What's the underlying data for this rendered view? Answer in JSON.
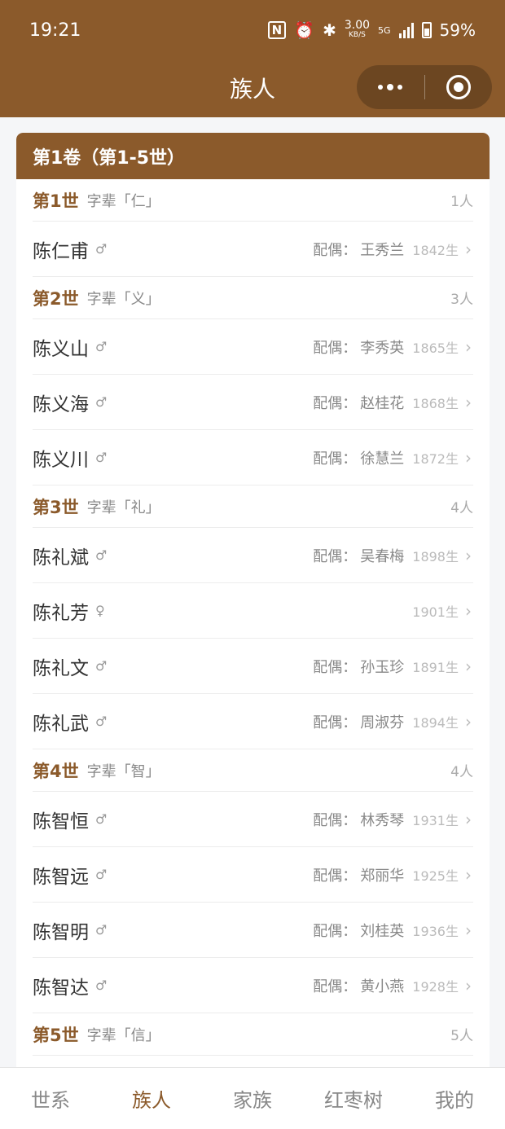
{
  "status_bar": {
    "time": "19:21",
    "speed_value": "3.00",
    "speed_unit": "KB/S",
    "network": "5G",
    "battery": "59%",
    "nfc": "N",
    "alarm": "⏰",
    "bluetooth": "✱"
  },
  "nav": {
    "title": "族人"
  },
  "colors": {
    "brand": "#8b5a2b",
    "background": "#f5f6f8"
  },
  "volume": {
    "title": "第1卷（第1-5世）"
  },
  "generations": [
    {
      "title": "第1世",
      "zibei": "字辈「仁」",
      "count": "1人",
      "members": [
        {
          "name": "陈仁甫",
          "gender": "♂",
          "spouse_label": "配偶：",
          "spouse": "王秀兰",
          "birth": "1842生"
        }
      ]
    },
    {
      "title": "第2世",
      "zibei": "字辈「义」",
      "count": "3人",
      "members": [
        {
          "name": "陈义山",
          "gender": "♂",
          "spouse_label": "配偶：",
          "spouse": "李秀英",
          "birth": "1865生"
        },
        {
          "name": "陈义海",
          "gender": "♂",
          "spouse_label": "配偶：",
          "spouse": "赵桂花",
          "birth": "1868生"
        },
        {
          "name": "陈义川",
          "gender": "♂",
          "spouse_label": "配偶：",
          "spouse": "徐慧兰",
          "birth": "1872生"
        }
      ]
    },
    {
      "title": "第3世",
      "zibei": "字辈「礼」",
      "count": "4人",
      "members": [
        {
          "name": "陈礼斌",
          "gender": "♂",
          "spouse_label": "配偶：",
          "spouse": "吴春梅",
          "birth": "1898生"
        },
        {
          "name": "陈礼芳",
          "gender": "♀",
          "spouse_label": "",
          "spouse": "",
          "birth": "1901生"
        },
        {
          "name": "陈礼文",
          "gender": "♂",
          "spouse_label": "配偶：",
          "spouse": "孙玉珍",
          "birth": "1891生"
        },
        {
          "name": "陈礼武",
          "gender": "♂",
          "spouse_label": "配偶：",
          "spouse": "周淑芬",
          "birth": "1894生"
        }
      ]
    },
    {
      "title": "第4世",
      "zibei": "字辈「智」",
      "count": "4人",
      "members": [
        {
          "name": "陈智恒",
          "gender": "♂",
          "spouse_label": "配偶：",
          "spouse": "林秀琴",
          "birth": "1931生"
        },
        {
          "name": "陈智远",
          "gender": "♂",
          "spouse_label": "配偶：",
          "spouse": "郑丽华",
          "birth": "1925生"
        },
        {
          "name": "陈智明",
          "gender": "♂",
          "spouse_label": "配偶：",
          "spouse": "刘桂英",
          "birth": "1936生"
        },
        {
          "name": "陈智达",
          "gender": "♂",
          "spouse_label": "配偶：",
          "spouse": "黄小燕",
          "birth": "1928生"
        }
      ]
    },
    {
      "title": "第5世",
      "zibei": "字辈「信」",
      "count": "5人",
      "members": []
    }
  ],
  "tabs": [
    {
      "label": "世系",
      "active": false
    },
    {
      "label": "族人",
      "active": true
    },
    {
      "label": "家族",
      "active": false
    },
    {
      "label": "红枣树",
      "active": false
    },
    {
      "label": "我的",
      "active": false
    }
  ]
}
